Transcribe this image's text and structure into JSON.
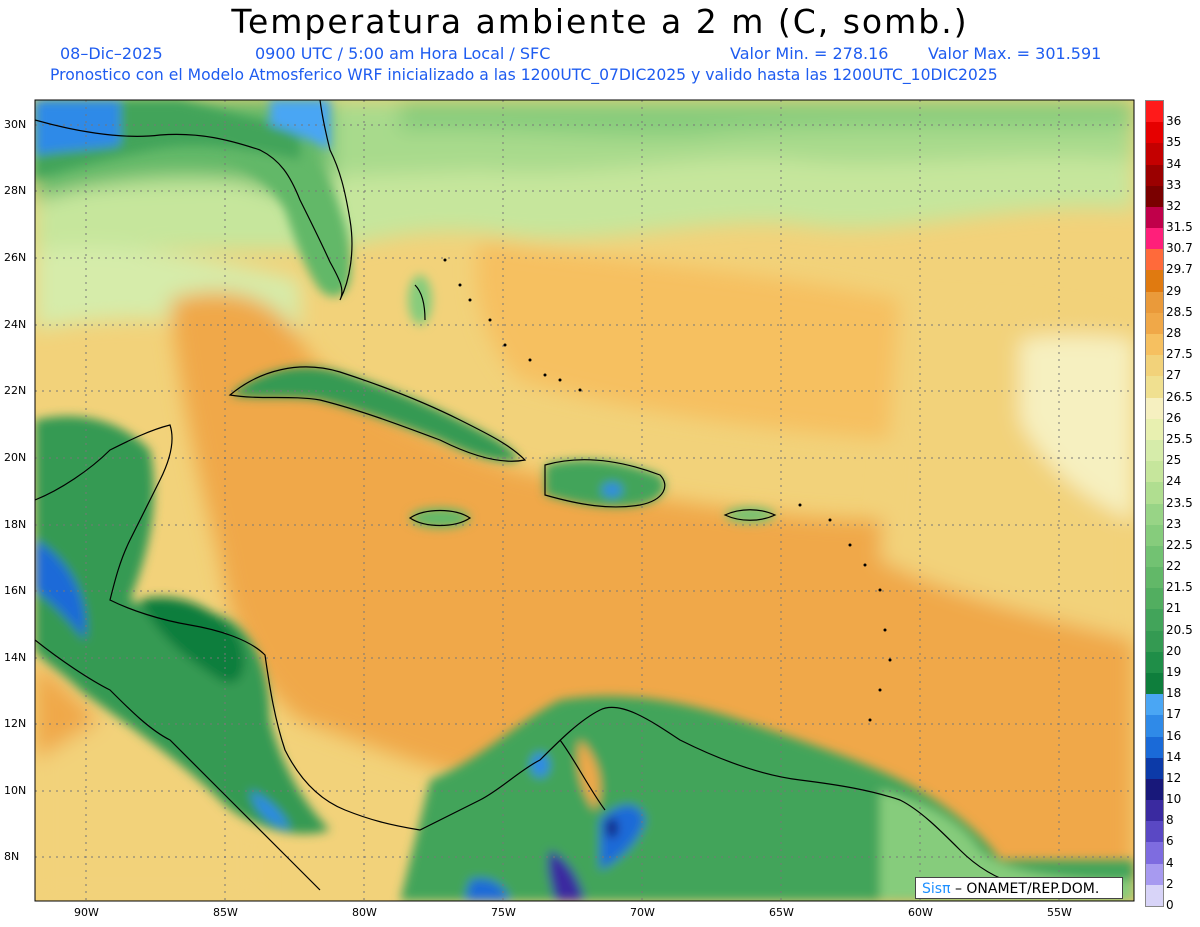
{
  "title": "Temperatura ambiente a 2 m (C, somb.)",
  "subtitle": {
    "date": "08–Dic–2025",
    "time": "0900 UTC / 5:00 am Hora Local / SFC",
    "valmin": "Valor Min. = 278.16",
    "valmax": "Valor Max. = 301.591",
    "line2": "Pronostico con el Modelo Atmosferico WRF inicializado a las 1200UTC_07DIC2025 y valido hasta las  1200UTC_10DIC2025"
  },
  "credit": {
    "logo": "Sisπ",
    "text": " – ONAMET/REP.DOM."
  },
  "lat_labels": [
    "30N",
    "28N",
    "26N",
    "24N",
    "22N",
    "20N",
    "18N",
    "16N",
    "14N",
    "12N",
    "10N",
    "8N"
  ],
  "lon_labels": [
    "90W",
    "85W",
    "80W",
    "75W",
    "70W",
    "65W",
    "60W",
    "55W"
  ],
  "colorbar": {
    "labels": [
      "36",
      "35",
      "34",
      "33",
      "32",
      "31.5",
      "30.7",
      "29.7",
      "29",
      "28.5",
      "28",
      "27.5",
      "27",
      "26.5",
      "26",
      "25.5",
      "25",
      "24",
      "23.5",
      "23",
      "22.5",
      "22",
      "21.5",
      "21",
      "20.5",
      "20",
      "19",
      "18",
      "17",
      "16",
      "14",
      "12",
      "10",
      "8",
      "6",
      "4",
      "2",
      "0"
    ],
    "colors": [
      "#ff1a1a",
      "#e60000",
      "#c40000",
      "#9b0000",
      "#7a0000",
      "#c0004a",
      "#ff1f7a",
      "#ff6a3a",
      "#e07a10",
      "#ea9a3a",
      "#f0a848",
      "#f6c060",
      "#f2d27a",
      "#f0e090",
      "#f6f0c0",
      "#e8f0b0",
      "#d6ecaa",
      "#c6e69c",
      "#b0de90",
      "#98d486",
      "#86cc7c",
      "#72c272",
      "#62b868",
      "#52ae60",
      "#42a45a",
      "#349a52",
      "#1f8e48",
      "#0e7e3c",
      "#4aa6f4",
      "#2f8ae8",
      "#1a6ad8",
      "#0c3aa8",
      "#18187a",
      "#3a2aa0",
      "#5a48c4",
      "#7e6ce0",
      "#a79af0",
      "#d8d4f8"
    ]
  },
  "map": {
    "lon_range": [
      -92,
      -52.5
    ],
    "lat_range": [
      6.8,
      30.6
    ]
  }
}
